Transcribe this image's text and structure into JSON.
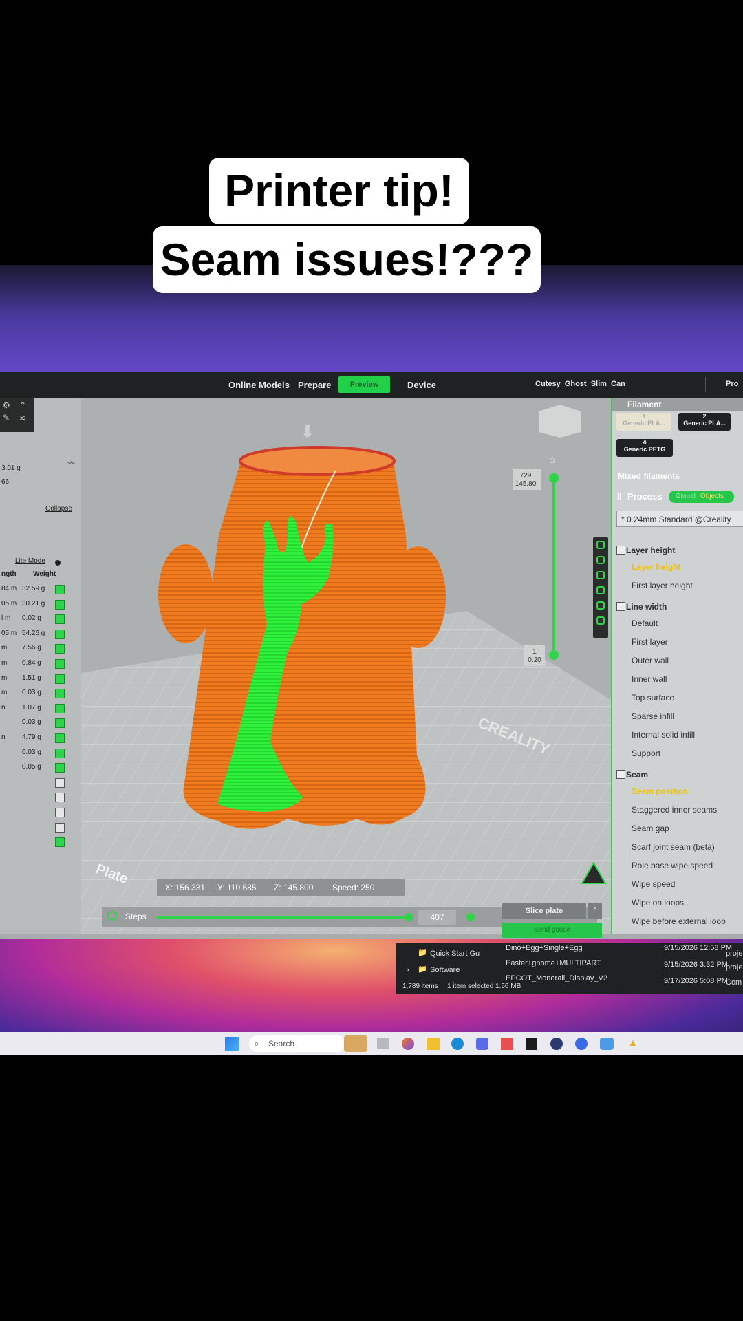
{
  "captions": {
    "line1": "Printer tip!",
    "line2": "Seam issues!???"
  },
  "menubar": {
    "online_models": "Online Models",
    "prepare": "Prepare",
    "preview": "Preview",
    "device": "Device",
    "file_name": "Cutesy_Ghost_Slim_Can",
    "pro": "Pro"
  },
  "left_panel": {
    "total_weight": "3.01 g",
    "number": "66",
    "collapse": "Collapse",
    "lite_mode": "Lite Mode",
    "col_length": "ngth",
    "col_weight": "Weight",
    "rows": [
      {
        "len": "84 m",
        "wt": "32.59 g",
        "checked": true
      },
      {
        "len": "05 m",
        "wt": "30.21 g",
        "checked": true
      },
      {
        "len": "l m",
        "wt": "0.02 g",
        "checked": true
      },
      {
        "len": "05 m",
        "wt": "54.26 g",
        "checked": true
      },
      {
        "len": "m",
        "wt": "7.56 g",
        "checked": true
      },
      {
        "len": "m",
        "wt": "0.84 g",
        "checked": true
      },
      {
        "len": "m",
        "wt": "1.51 g",
        "checked": true
      },
      {
        "len": "m",
        "wt": "0.03 g",
        "checked": true
      },
      {
        "len": "n",
        "wt": "1.07 g",
        "checked": true
      },
      {
        "len": "",
        "wt": "0.03 g",
        "checked": true
      },
      {
        "len": "n",
        "wt": "4.79 g",
        "checked": true
      },
      {
        "len": "",
        "wt": "0.03 g",
        "checked": true
      },
      {
        "len": "",
        "wt": "0.05 g",
        "checked": true
      },
      {
        "len": "",
        "wt": "",
        "checked": false
      },
      {
        "len": "",
        "wt": "",
        "checked": false
      },
      {
        "len": "",
        "wt": "",
        "checked": false
      },
      {
        "len": "",
        "wt": "",
        "checked": false
      },
      {
        "len": "",
        "wt": "",
        "checked": true
      }
    ]
  },
  "viewport": {
    "layer_top": "729",
    "height_top": "145.80",
    "layer_bottom": "1",
    "height_bottom": "0.20",
    "coords": {
      "x": "X: 156.331",
      "y": "Y: 110.685",
      "z": "Z: 145.800",
      "speed": "Speed: 250"
    },
    "steps_label": "Steps",
    "steps_value": "407",
    "plate_label": "Plate",
    "bed_brand": "CREALITY"
  },
  "right_panel": {
    "filament_title": "Filament",
    "filaments": [
      {
        "num": "1",
        "name": "Generic PLA..."
      },
      {
        "num": "2",
        "name": "Generic PLA..."
      },
      {
        "num": "4",
        "name": "Generic PETG"
      }
    ],
    "mixed_filaments": "Mixed filaments",
    "process": "Process",
    "toggle_global": "Global",
    "toggle_objects": "Objects",
    "preset": "* 0.24mm Standard @Creality",
    "sections": [
      {
        "title": "Layer height",
        "items": [
          "Layer height",
          "First layer height"
        ],
        "active": "Layer height"
      },
      {
        "title": "Line width",
        "items": [
          "Default",
          "First layer",
          "Outer wall",
          "Inner wall",
          "Top surface",
          "Sparse infill",
          "Internal solid infill",
          "Support"
        ]
      },
      {
        "title": "Seam",
        "items": [
          "Seam position",
          "Staggered inner seams",
          "Seam gap",
          "Scarf joint seam (beta)",
          "Role base wipe speed",
          "Wipe speed",
          "Wipe on loops",
          "Wipe before external loop"
        ],
        "active": "Seam position"
      }
    ],
    "slice_plate": "Slice plate",
    "send_gcode": "Send gcode"
  },
  "explorer": {
    "folders": [
      "Quick Start Gu",
      "Software"
    ],
    "files": [
      {
        "name": "Dino+Egg+Single+Egg",
        "date": "9/15/2026 12:58 PM",
        "type": "proje"
      },
      {
        "name": "Easter+gnome+MULTIPART",
        "date": "9/15/2026 3:32 PM",
        "type": "proje"
      },
      {
        "name": "EPCOT_Monorail_Display_V2",
        "date": "9/17/2026 5:08 PM",
        "type": "Com"
      }
    ],
    "status": "1,789 items",
    "selection": "1 item selected  1.56 MB"
  },
  "taskbar": {
    "search_placeholder": "Search"
  },
  "colors": {
    "accent": "#2fd44a",
    "model": "#f07a1e",
    "seam": "#2ef23a",
    "highlight": "#f0c000"
  }
}
